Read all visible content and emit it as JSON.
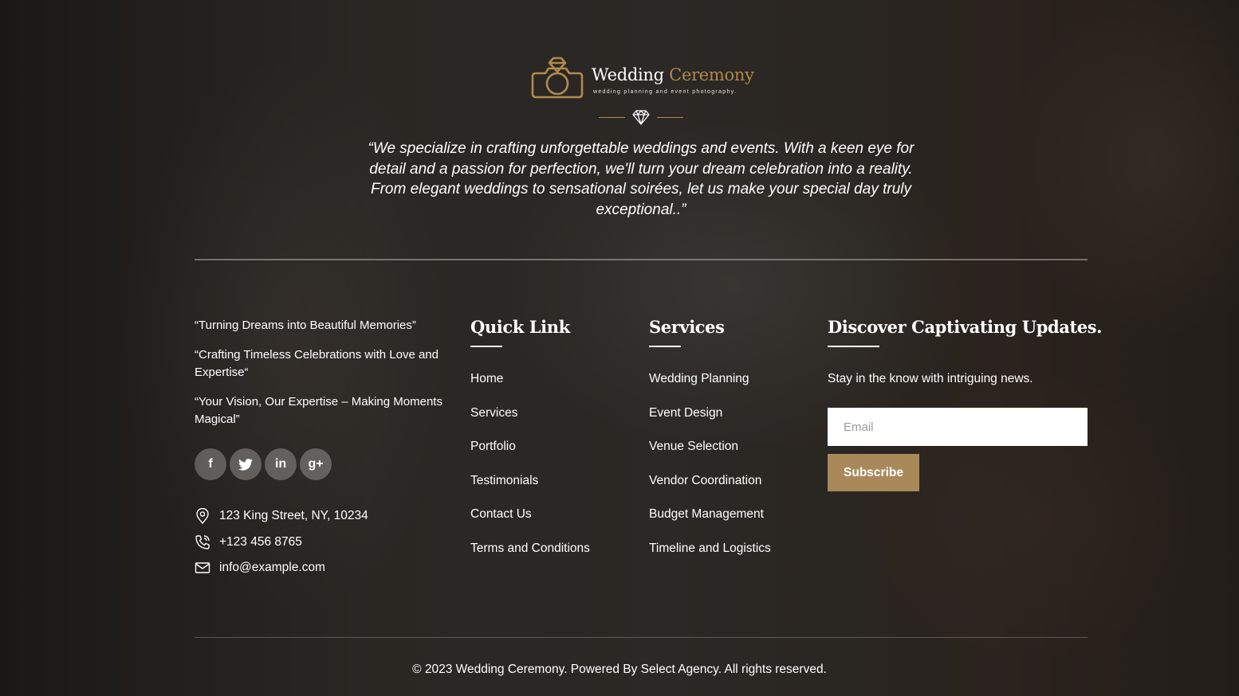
{
  "brand": {
    "name_part1": "Wedding",
    "name_part2": "Ceremony",
    "tagline": "wedding planning and event photography.",
    "accent_color": "#b0894f"
  },
  "hero_quote": "“We specialize in crafting unforgettable weddings and events. With a keen eye for detail and a passion for perfection, we'll turn your dream celebration into a reality. From elegant weddings to sensational soirées, let us make your special day truly exceptional..”",
  "about": {
    "taglines": [
      "“Turning Dreams into Beautiful Memories”",
      "“Crafting Timeless Celebrations with Love and Expertise“",
      "“Your Vision, Our Expertise – Making Moments Magical”"
    ],
    "social": [
      {
        "icon": "facebook-icon",
        "glyph": "f"
      },
      {
        "icon": "twitter-icon",
        "glyph": "t"
      },
      {
        "icon": "linkedin-icon",
        "glyph": "in"
      },
      {
        "icon": "google-plus-icon",
        "glyph": "g+"
      }
    ],
    "contact": {
      "address": "123 King Street, NY, 10234",
      "phone": "+123 456 8765",
      "email": "info@example.com"
    }
  },
  "quick_link": {
    "title": "Quick Link",
    "items": [
      "Home",
      "Services",
      "Portfolio",
      "Testimonials",
      "Contact Us",
      "Terms and Conditions"
    ]
  },
  "services": {
    "title": "Services",
    "items": [
      "Wedding Planning",
      "Event Design",
      "Venue Selection",
      "Vendor Coordination",
      "Budget Management",
      "Timeline and Logistics"
    ]
  },
  "newsletter": {
    "title": "Discover Captivating Updates.",
    "text": "Stay in the know with intriguing news.",
    "email_placeholder": "Email",
    "subscribe_label": "Subscribe",
    "button_color": "#a9885a"
  },
  "footer": {
    "copyright": "© 2023 Wedding Ceremony. Powered By Select Agency. All rights reserved."
  }
}
